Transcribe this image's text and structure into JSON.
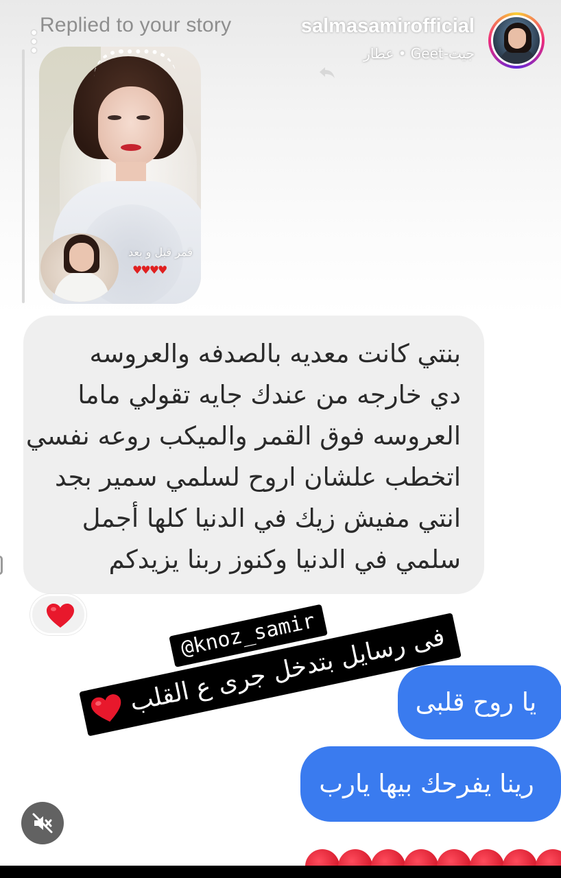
{
  "story_header": {
    "replied_label": "Replied to your story",
    "username": "salmasamirofficial",
    "subtitle": "عطار • Geet-جيت",
    "icons": [
      "menu-dots-icon",
      "reply-arrow-icon",
      "avatar"
    ]
  },
  "story_thumbnail": {
    "caption": "قمر قبل و بعد",
    "hearts": "♥♥♥♥"
  },
  "incoming_message": {
    "lines": [
      "بنتي كانت معديه بالصدفه والعروسه",
      "دي خارجه من عندك جايه تقولي ماما",
      "العروسه فوق القمر والميكب روعه نفسي",
      "اتخطب علشان اروح لسلمي سمير بجد",
      "انتي مفيش زيك في الدنيا كلها أجمل",
      "سلمي في الدنيا وكنوز ربنا يزيدكم"
    ],
    "reaction_icon": "red-heart-icon"
  },
  "sticker": {
    "mention": "@knoz_samir",
    "caption": "فى رسايل بتدخل جرى ع القلب"
  },
  "outgoing_messages": [
    {
      "text": "يا روح قلبى"
    },
    {
      "text": "رينا يفرحك بيها يارب"
    }
  ],
  "controls": {
    "mute_icon": "speaker-muted-icon"
  },
  "colors": {
    "outgoing_bubble": "#3a7bef",
    "incoming_bubble": "#efefef",
    "heart": "#e8182c",
    "sticker_bg": "#000000"
  }
}
